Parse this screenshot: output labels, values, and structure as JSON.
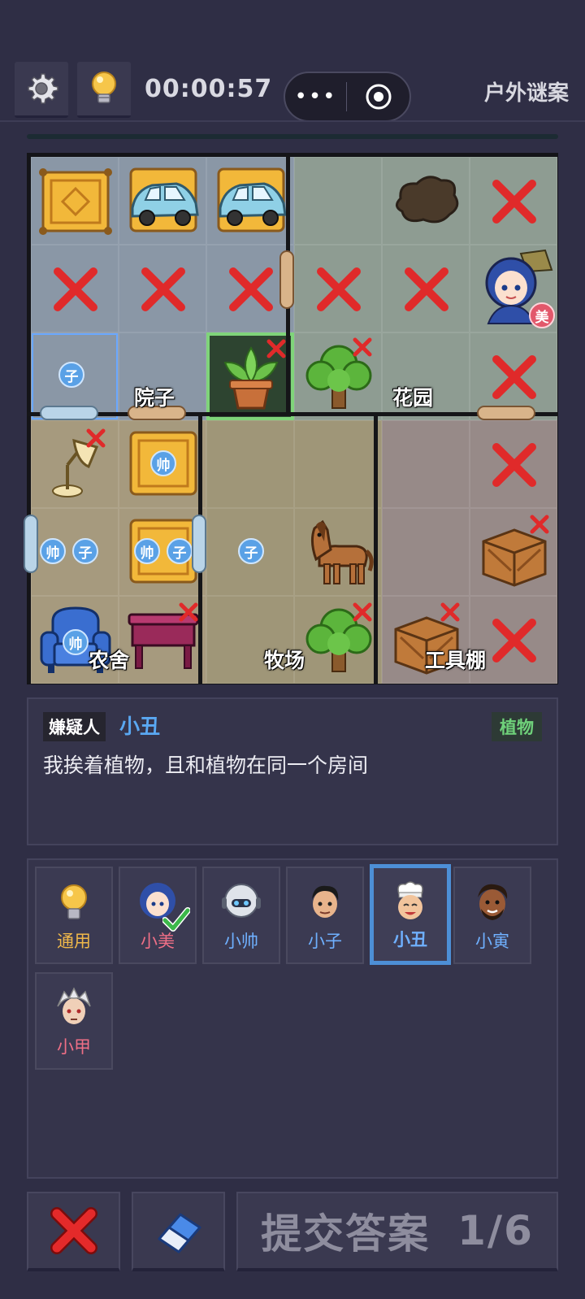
{
  "header": {
    "settings_icon": "gear-icon",
    "hint_icon": "lightbulb-icon",
    "timer": "00:00:57",
    "menu_dots": "•••",
    "mode_title": "户外谜案"
  },
  "board": {
    "rooms": {
      "yard": "院子",
      "garden": "花园",
      "barn": "农舍",
      "ranch": "牧场",
      "shed": "工具棚"
    },
    "badges": {
      "zi": "子",
      "shuai": "帅",
      "mei": "美"
    }
  },
  "clue": {
    "tag": "嫌疑人",
    "suspect": "小丑",
    "category": "植物",
    "text": "我挨着植物，且和植物在同一个房间"
  },
  "characters": [
    {
      "name": "通用",
      "color": "#f0b84a"
    },
    {
      "name": "小美",
      "color": "#ef6f86"
    },
    {
      "name": "小帅",
      "color": "#6fb0ff"
    },
    {
      "name": "小子",
      "color": "#6fb0ff"
    },
    {
      "name": "小丑",
      "color": "#6fb0ff"
    },
    {
      "name": "小寅",
      "color": "#6fb0ff"
    },
    {
      "name": "小甲",
      "color": "#ef6f86"
    }
  ],
  "footer": {
    "submit_label": "提交答案",
    "progress": "1/6"
  }
}
